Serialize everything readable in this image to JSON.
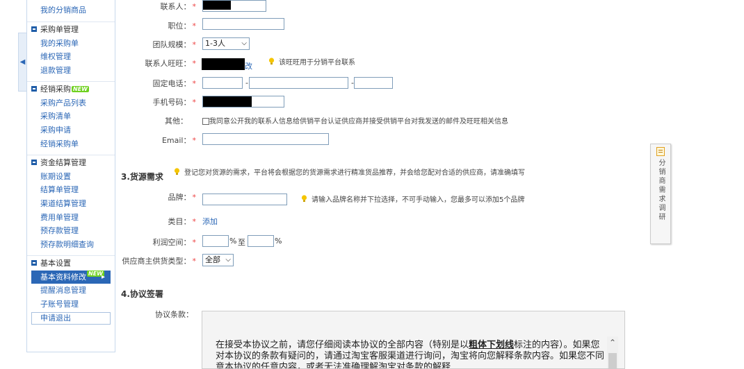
{
  "sidebar": {
    "top_item": "我的分销商品",
    "groups": [
      {
        "title": "采购单管理",
        "items": [
          "我的采购单",
          "维权管理",
          "退款管理"
        ]
      },
      {
        "title": "经销采购",
        "new": "NEW",
        "items": [
          "采购产品列表",
          "采购清单",
          "采购申请",
          "经销采购单"
        ]
      },
      {
        "title": "资金结算管理",
        "items": [
          "账期设置",
          "结算单管理",
          "渠道结算管理",
          "费用单管理",
          "预存款管理",
          "预存款明细查询"
        ]
      },
      {
        "title": "基本设置",
        "items": [
          "基本资料修改",
          "提醒消息管理",
          "子账号管理",
          "申请退出"
        ],
        "active_new": "NEW"
      }
    ]
  },
  "form": {
    "contact_label": "联系人：",
    "position_label": "职位：",
    "team_label": "团队规模：",
    "team_value": "1-3人",
    "wangwang_label": "联系人旺旺：",
    "wangwang_edit": "改",
    "wangwang_tip": "该旺旺用于分销平台联系",
    "phone_label": "固定电话：",
    "phone_sep1": "-",
    "phone_sep2": "-",
    "mobile_label": "手机号码：",
    "other_label": "其他：",
    "other_text": "我同意公开我的联系人信息给供销平台认证供应商并接受供销平台对我发送的邮件及旺旺相关信息",
    "email_label": "Email："
  },
  "section3": {
    "title": "3.货源需求",
    "tip": "登记您对货源的需求，平台将会根据您的货源需求进行精准货品推荐，并会给您配对合适的供应商，请准确填写",
    "brand_label": "品牌：",
    "brand_tip": "请输入品牌名称并下拉选择，不可手动输入，您最多可以添加5个品牌",
    "category_label": "类目：",
    "category_link": "添加",
    "profit_label": "利润空间：",
    "profit_pct1": "%",
    "profit_to": "至",
    "profit_pct2": "%",
    "supplier_type_label": "供应商主供货类型：",
    "supplier_type_value": "全部"
  },
  "section4": {
    "title": "4.协议签署",
    "terms_label": "协议条款：",
    "terms_text_1": "在接受本协议之前，请您仔细阅读本协议的全部内容（特别是以",
    "terms_bold": "粗体下划线",
    "terms_text_2": "标注的内容）。如果您对本协议的条款有疑问的，请通过淘宝客服渠道进行询问，淘宝将向您解释条款内容。如果您不同意本协议的任意内容，或者无法准确理解淘宝对条款的解释"
  },
  "survey_tab": "分销商需求调研",
  "colors": {
    "link": "#2b67b6",
    "required": "#ee4444",
    "new_badge": "#6fd120"
  }
}
